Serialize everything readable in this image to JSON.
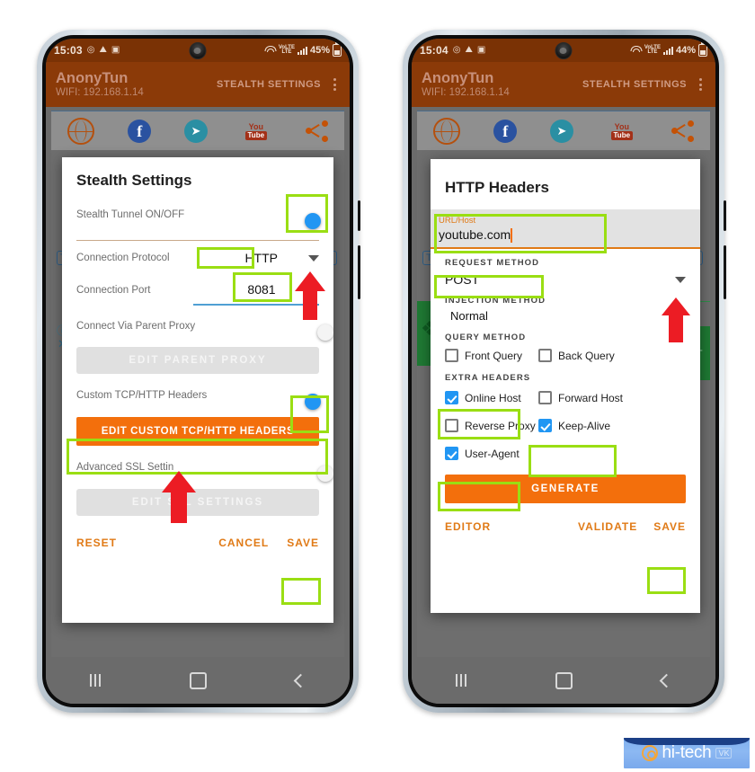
{
  "phones": [
    {
      "id": "left",
      "statusbar": {
        "time": "15:03",
        "icons": [
          "screen-record-icon",
          "app-icon",
          "gallery-icon"
        ],
        "network": "VoLTE",
        "battery": "45%"
      },
      "appbar": {
        "app_name": "AnonyTun",
        "connection": "WIFI: 192.168.1.14",
        "action": "STEALTH SETTINGS",
        "menu": "overflow-menu"
      },
      "shortcuts": [
        "globe-icon",
        "facebook-icon",
        "telegram-icon",
        "youtube-icon",
        "share-icon"
      ],
      "dialog": {
        "title": "Stealth Settings",
        "rows": [
          {
            "label": "Stealth Tunnel ON/OFF",
            "control": "toggle",
            "state": "on",
            "highlight": true
          },
          {
            "label": "Connection Protocol",
            "control": "dropdown",
            "value": "HTTP",
            "highlight": true
          },
          {
            "label": "Connection Port",
            "control": "input",
            "value": "8081",
            "highlight": true
          },
          {
            "label": "Connect Via Parent Proxy",
            "control": "toggle",
            "state": "off",
            "highlight": false
          },
          {
            "label": "Custom TCP/HTTP Headers",
            "control": "toggle",
            "state": "on",
            "highlight": true
          },
          {
            "label": "Advanced SSL Settin",
            "control": "toggle",
            "state": "off",
            "highlight": false
          }
        ],
        "buttons": {
          "edit_parent_proxy": "EDIT PARENT PROXY",
          "edit_custom_headers": "EDIT CUSTOM TCP/HTTP HEADERS",
          "edit_ssl": "EDIT SSL SETTINGS"
        },
        "actions": {
          "reset": "RESET",
          "cancel": "CANCEL",
          "save": "SAVE"
        }
      },
      "navbar": [
        "recents-icon",
        "home-icon",
        "back-icon"
      ]
    },
    {
      "id": "right",
      "statusbar": {
        "time": "15:04",
        "icons": [
          "screen-record-icon",
          "app-icon",
          "gallery-icon"
        ],
        "network": "VoLTE",
        "battery": "44%"
      },
      "appbar": {
        "app_name": "AnonyTun",
        "connection": "WIFI: 192.168.1.14",
        "action": "STEALTH SETTINGS",
        "menu": "overflow-menu"
      },
      "shortcuts": [
        "globe-icon",
        "facebook-icon",
        "telegram-icon",
        "youtube-icon",
        "share-icon"
      ],
      "dialog": {
        "title": "HTTP Headers",
        "url_field": {
          "label": "URL/Host",
          "value": "youtube.com",
          "highlight": true
        },
        "request_method": {
          "label": "REQUEST METHOD",
          "value": "POST",
          "highlight": true
        },
        "injection_method": {
          "label": "INJECTION METHOD",
          "value": "Normal"
        },
        "query_method": {
          "label": "QUERY METHOD",
          "items": [
            {
              "label": "Front Query",
              "checked": false,
              "highlight": false
            },
            {
              "label": "Back Query",
              "checked": false,
              "highlight": false
            }
          ]
        },
        "extra_headers": {
          "label": "EXTRA HEADERS",
          "items": [
            {
              "label": "Online Host",
              "checked": true,
              "highlight": true
            },
            {
              "label": "Forward Host",
              "checked": false,
              "highlight": false
            },
            {
              "label": "Reverse Proxy",
              "checked": false,
              "highlight": false
            },
            {
              "label": "Keep-Alive",
              "checked": true,
              "highlight": true
            },
            {
              "label": "User-Agent",
              "checked": true,
              "highlight": true
            }
          ]
        },
        "generate_button": "GENERATE",
        "actions": {
          "editor": "EDITOR",
          "validate": "VALIDATE",
          "save": "SAVE"
        }
      },
      "navbar": [
        "recents-icon",
        "home-icon",
        "back-icon"
      ]
    }
  ],
  "watermark": {
    "text": "hi-tech",
    "at": "at-icon",
    "badge": "VK"
  },
  "colors": {
    "appbar": "#8b3a08",
    "statusbar": "#7a3205",
    "accent_orange": "#f36f0c",
    "highlight_green": "#9ade13",
    "arrow_red": "#ec1c24",
    "toggle_on": "#2196f3",
    "checkbox_on": "#2196f3"
  }
}
